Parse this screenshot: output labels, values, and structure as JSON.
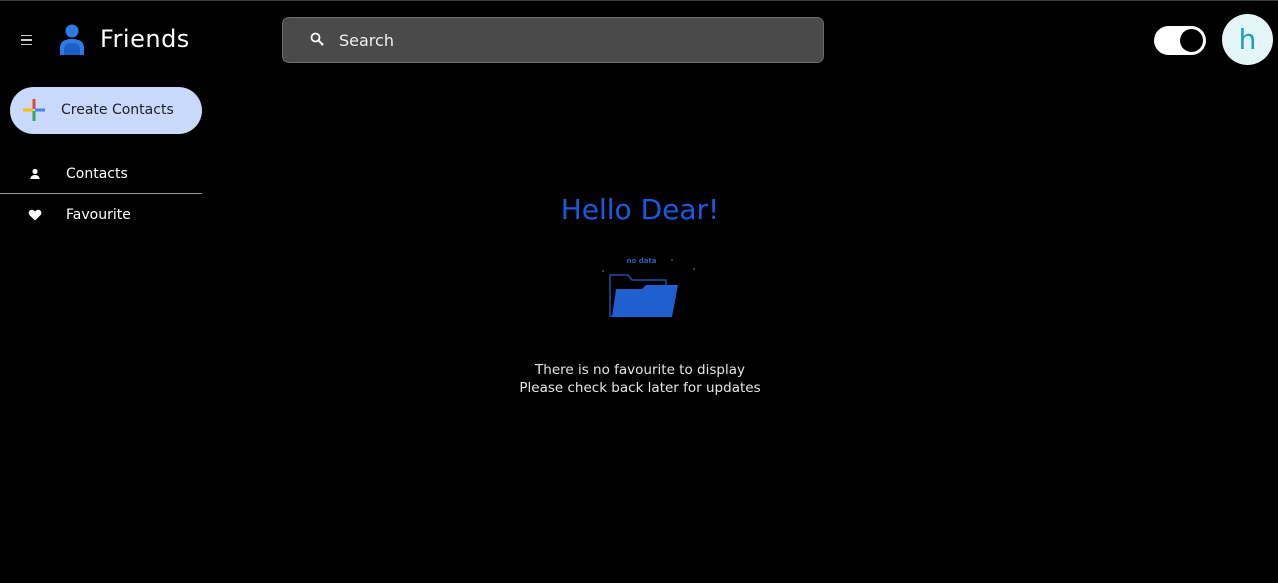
{
  "header": {
    "app_title": "Friends",
    "menu_icon": "hamburger-menu-icon",
    "logo_icon": "person-icon",
    "search": {
      "placeholder": "Search",
      "value": "",
      "icon": "search-icon"
    },
    "theme_toggle": {
      "state": "dark"
    },
    "avatar": {
      "letter": "h"
    }
  },
  "sidebar": {
    "create_button": {
      "label": "Create Contacts",
      "icon": "multicolor-plus-icon"
    },
    "items": [
      {
        "label": "Contacts",
        "icon": "person-icon",
        "active": false
      },
      {
        "label": "Favourite",
        "icon": "heart-icon",
        "active": true
      }
    ]
  },
  "main": {
    "greeting": "Hello Dear!",
    "illustration_label": "no data",
    "empty_line1": "There is no favourite to display",
    "empty_line2": "Please check back later for updates"
  },
  "colors": {
    "background": "#000000",
    "accent_blue": "#1a5ae0",
    "create_button_bg": "#c9d9fb",
    "search_bg": "#4a4a4a",
    "avatar_bg": "#e3f5f7",
    "avatar_text": "#1aa3b8"
  }
}
